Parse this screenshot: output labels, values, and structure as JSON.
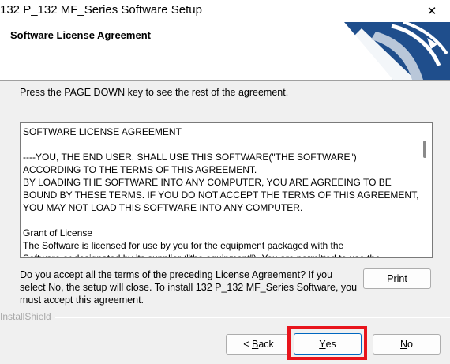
{
  "window": {
    "title": "132 P_132 MF_Series Software Setup",
    "close_glyph": "✕"
  },
  "header": {
    "title": "Software License Agreement"
  },
  "instruction": "Press the PAGE DOWN key to see the rest of the agreement.",
  "license_text": "SOFTWARE LICENSE AGREEMENT\n\n----YOU, THE END USER, SHALL USE THIS SOFTWARE(\"THE SOFTWARE\")\nACCORDING TO THE TERMS OF THIS AGREEMENT.\nBY LOADING THE SOFTWARE INTO ANY COMPUTER, YOU ARE AGREEING TO BE\nBOUND BY THESE TERMS. IF YOU DO NOT ACCEPT THE TERMS OF THIS AGREEMENT,\nYOU MAY NOT LOAD THIS SOFTWARE INTO ANY COMPUTER.\n\nGrant of License\nThe Software is licensed for use by you for the equipment packaged with the\nSoftware or designated by its supplier (\"the equipment\"). You are permitted to use the",
  "question": "Do you accept all the terms of the preceding License Agreement?  If you select No,  the setup will close.  To install 132 P_132 MF_Series Software, you must accept this agreement.",
  "buttons": {
    "print": {
      "accel": "P",
      "rest": "rint"
    },
    "back": {
      "prefix": "< ",
      "accel": "B",
      "rest": "ack"
    },
    "yes": {
      "accel": "Y",
      "rest": "es"
    },
    "no": {
      "accel": "N",
      "rest": "o"
    }
  },
  "installshield_label": "InstallShield",
  "colors": {
    "highlight": "#e8141c",
    "logo_blue": "#1f4e8c",
    "focus_border": "#0067c0"
  }
}
